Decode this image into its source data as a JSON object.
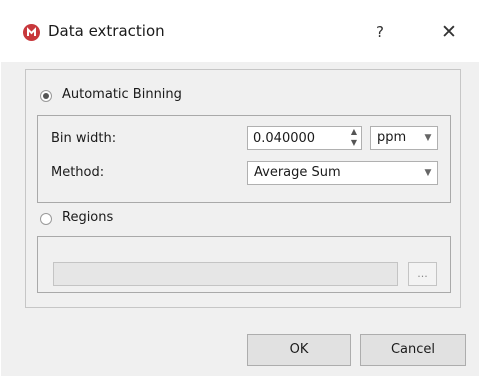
{
  "window": {
    "title": "Data extraction",
    "help_label": "?",
    "close_label": "✕"
  },
  "automatic_binning": {
    "label": "Automatic Binning",
    "selected": true,
    "bin_width": {
      "label": "Bin width:",
      "value": "0.040000",
      "unit": "ppm"
    },
    "method": {
      "label": "Method:",
      "value": "Average Sum"
    }
  },
  "regions": {
    "label": "Regions",
    "selected": false,
    "path_value": "",
    "browse_label": "..."
  },
  "buttons": {
    "ok_label": "OK",
    "cancel_label": "Cancel"
  },
  "icons": {
    "app": "app-logo-icon",
    "help": "help-icon",
    "close": "close-icon",
    "spin_up": "chevron-up-icon",
    "spin_down": "chevron-down-icon",
    "dropdown": "chevron-down-icon"
  },
  "colors": {
    "app_icon": "#c8383c",
    "dialog_bg": "#f0f0f0"
  }
}
